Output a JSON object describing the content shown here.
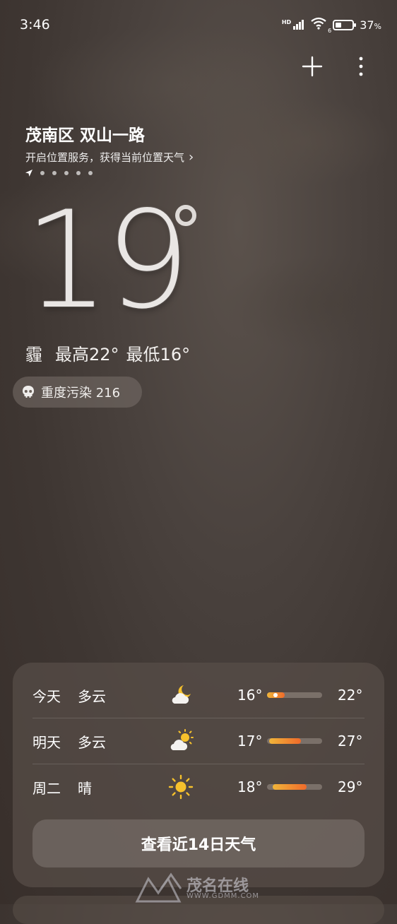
{
  "status_bar": {
    "time": "3:46",
    "hd": "HD",
    "battery_percent": "37",
    "battery_level": 0.37,
    "wifi_label": "6"
  },
  "location": {
    "name": "茂南区 双山一路",
    "hint": "开启位置服务，获得当前位置天气",
    "hint_chevron": "›"
  },
  "current": {
    "temperature": "19",
    "condition": "霾",
    "high": "最高22°",
    "low": "最低16°"
  },
  "aqi": {
    "label": "重度污染 216",
    "icon": "skull-icon"
  },
  "forecast": [
    {
      "day": "今天",
      "cond": "多云",
      "icon": "cloud-moon-icon",
      "low": "16°",
      "high": "22°",
      "bar_start": 0.0,
      "bar_end": 0.32
    },
    {
      "day": "明天",
      "cond": "多云",
      "icon": "cloud-sun-icon",
      "low": "17°",
      "high": "27°",
      "bar_start": 0.04,
      "bar_end": 0.62
    },
    {
      "day": "周二",
      "cond": "晴",
      "icon": "sun-icon",
      "low": "18°",
      "high": "29°",
      "bar_start": 0.1,
      "bar_end": 0.72
    }
  ],
  "forecast_button": "查看近14日天气",
  "watermark": {
    "name": "茂名在线",
    "url": "WWW.GDMM.COM"
  },
  "colors": {
    "bar_gold": "#f0b53a",
    "bar_orange": "#ef6a2a",
    "sun": "#f6c12c"
  }
}
